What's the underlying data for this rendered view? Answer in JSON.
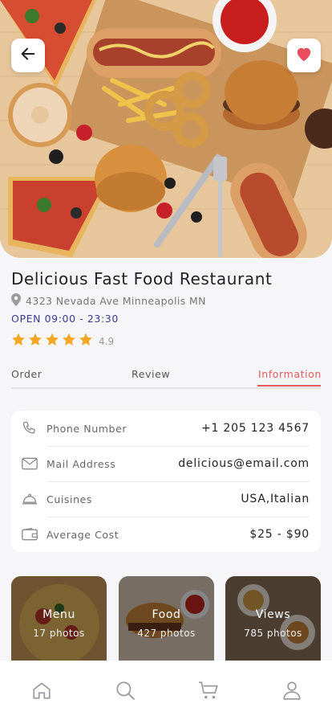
{
  "header": {
    "back_icon": "arrow-left-icon",
    "favorite_icon": "heart-icon",
    "favorite_color": "#ea4d5c"
  },
  "restaurant": {
    "name": "Delicious Fast Food Restaurant",
    "address": "4323 Nevada Ave Minneapolis MN",
    "hours": "OPEN 09:00 - 23:30",
    "rating": "4.9",
    "stars": 5,
    "star_color": "#f5a623"
  },
  "tabs": [
    {
      "label": "Order"
    },
    {
      "label": "Review"
    },
    {
      "label": "Information",
      "active": true
    }
  ],
  "accent_color": "#e45b5b",
  "info": [
    {
      "icon": "phone-icon",
      "label": "Phone Number",
      "value": "+1 205 123 4567"
    },
    {
      "icon": "mail-icon",
      "label": "Mail Address",
      "value": "delicious@email.com"
    },
    {
      "icon": "cloche-icon",
      "label": "Cuisines",
      "value": "USA,Italian"
    },
    {
      "icon": "wallet-icon",
      "label": "Average Cost",
      "value": "$25 - $90"
    }
  ],
  "photos": [
    {
      "title": "Menu",
      "count": "17 photos"
    },
    {
      "title": "Food",
      "count": "427 photos"
    },
    {
      "title": "Views",
      "count": "785 photos"
    }
  ],
  "nav": [
    {
      "icon": "home-icon"
    },
    {
      "icon": "search-icon"
    },
    {
      "icon": "cart-icon"
    },
    {
      "icon": "profile-icon"
    }
  ]
}
